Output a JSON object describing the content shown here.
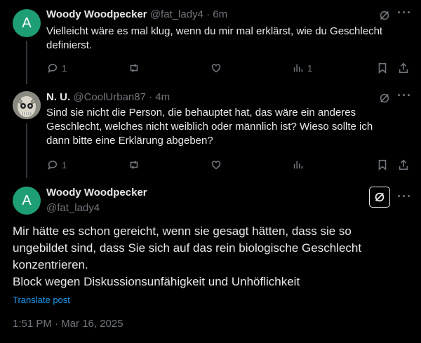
{
  "tweets": [
    {
      "name": "Woody Woodpecker",
      "handle": "@fat_lady4",
      "time": "· 6m",
      "avatar_letter": "A",
      "text": "Vielleicht wäre es mal klug, wenn du mir mal erklärst, wie du Geschlecht definierst.",
      "replies": "1",
      "views": "1"
    },
    {
      "name": "N. U.",
      "handle": "@CoolUrban87",
      "time": "· 4m",
      "text": "Sind sie nicht die Person, die behauptet hat, das wäre ein anderes Geschlecht, welches nicht weiblich oder männlich ist? Wieso sollte ich dann bitte eine Erklärung abgeben?",
      "replies": "1"
    }
  ],
  "main_tweet": {
    "name": "Woody Woodpecker",
    "handle": "@fat_lady4",
    "avatar_letter": "A",
    "text_line1": "Mir hätte es schon gereicht, wenn sie gesagt hätten, dass sie so ungebildet sind, dass Sie sich auf das rein biologische Geschlecht konzentrieren.",
    "text_line2": "Block wegen Diskussionsunfähigkeit und Unhöflichkeit",
    "translate_label": "Translate post",
    "timestamp": "1:51 PM · Mar 16, 2025"
  },
  "icons": [
    "grok-icon",
    "more-icon",
    "reply-icon",
    "retweet-icon",
    "like-icon",
    "views-icon",
    "bookmark-icon",
    "share-icon"
  ],
  "colors": {
    "avatar": "#1d9e75",
    "link": "#1d9bf0",
    "muted": "#71767b",
    "text": "#e7e9ea"
  }
}
